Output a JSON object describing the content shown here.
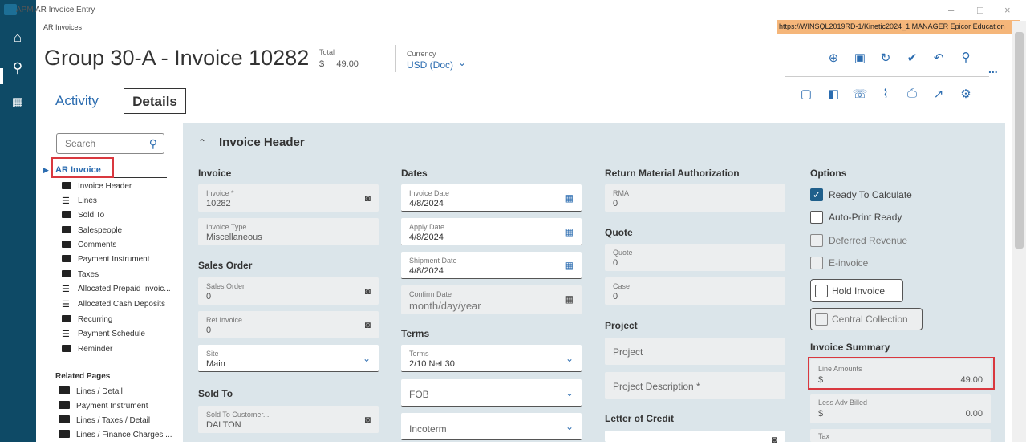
{
  "window": {
    "title": "APM AR Invoice Entry",
    "minimize": "–",
    "maximize": "□",
    "close": "×"
  },
  "breadcrumb": "AR Invoices",
  "url_bar": "https://WINSQL2019RD-1/Kinetic2024_1  MANAGER  Epicor Education",
  "header": {
    "title": "Group 30-A - Invoice 10282",
    "total_label": "Total",
    "total_value": "$     49.00",
    "currency_label": "Currency",
    "currency_value": "USD (Doc)",
    "more": "..."
  },
  "tabs": {
    "activity": "Activity",
    "details": "Details"
  },
  "sidebar": {
    "search_placeholder": "Search",
    "root": "AR Invoice",
    "items": [
      "Invoice Header",
      "Lines",
      "Sold To",
      "Salespeople",
      "Comments",
      "Payment Instrument",
      "Taxes",
      "Allocated Prepaid Invoic...",
      "Allocated Cash Deposits",
      "Recurring",
      "Payment Schedule",
      "Reminder"
    ],
    "related_title": "Related Pages",
    "related": [
      "Lines / Detail",
      "Payment Instrument",
      "Lines / Taxes / Detail",
      "Lines / Finance Charges ..."
    ]
  },
  "section": {
    "title": "Invoice Header"
  },
  "col_invoice": {
    "heading": "Invoice",
    "invoice_label": "Invoice *",
    "invoice_value": "10282",
    "type_label": "Invoice Type",
    "type_value": "Miscellaneous",
    "so_heading": "Sales Order",
    "so_label": "Sales Order",
    "so_value": "0",
    "ref_label": "Ref Invoice...",
    "ref_value": "0",
    "site_label": "Site",
    "site_value": "Main",
    "soldto_heading": "Sold To",
    "cust_label": "Sold To Customer...",
    "cust_value": "DALTON"
  },
  "col_dates": {
    "heading": "Dates",
    "inv_date_label": "Invoice Date",
    "inv_date_value": "4/8/2024",
    "apply_label": "Apply Date",
    "apply_value": "4/8/2024",
    "ship_label": "Shipment Date",
    "ship_value": "4/8/2024",
    "confirm_label": "Confirm Date",
    "confirm_value": "month/day/year",
    "terms_heading": "Terms",
    "terms_label": "Terms",
    "terms_value": "2/10 Net 30",
    "fob": "FOB",
    "incoterm": "Incoterm"
  },
  "col_rma": {
    "heading": "Return Material Authorization",
    "rma_label": "RMA",
    "rma_value": "0",
    "quote_heading": "Quote",
    "quote_label": "Quote",
    "quote_value": "0",
    "case_label": "Case",
    "case_value": "0",
    "project_heading": "Project",
    "project": "Project",
    "project_desc": "Project Description *",
    "loc_heading": "Letter of Credit"
  },
  "col_options": {
    "heading": "Options",
    "ready": "Ready To Calculate",
    "autoprint": "Auto-Print Ready",
    "deferred": "Deferred Revenue",
    "einvoice": "E-invoice",
    "hold": "Hold Invoice",
    "central": "Central Collection",
    "summary_heading": "Invoice Summary",
    "line_amounts_label": "Line Amounts",
    "line_amounts_cur": "$",
    "line_amounts_value": "49.00",
    "adv_label": "Less Adv Billed",
    "adv_cur": "$",
    "adv_value": "0.00",
    "tax_label": "Tax"
  }
}
